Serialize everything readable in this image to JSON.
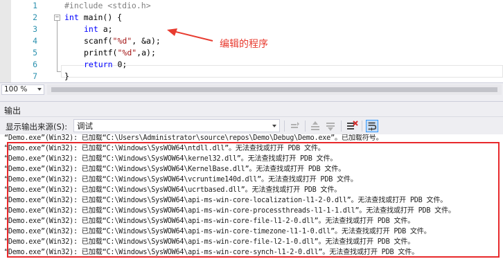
{
  "editor": {
    "line_numbers": [
      "1",
      "2",
      "3",
      "4",
      "5",
      "6",
      "7"
    ],
    "include_text": "#include <stdio.h>",
    "main_kw": "int",
    "main_sig": " main() {",
    "decl_kw": "int",
    "decl_rest": " a;",
    "scanf_pre": "scanf(",
    "scanf_str": "\"%d\"",
    "scanf_post": ", &a);",
    "printf_pre": "printf(",
    "printf_str": "\"%d\"",
    "printf_post": ",a);",
    "return_kw": "return",
    "return_rest": " 0;",
    "close_brace": "}",
    "fold_symbol": "−"
  },
  "annotation": {
    "text": "编辑的程序",
    "color": "#e83b2f"
  },
  "zoombar": {
    "zoom_level": "100 %"
  },
  "output": {
    "title": "输出",
    "source_label": "显示输出来源(S):",
    "source_value": "调试",
    "lines": [
      "“Demo.exe”(Win32): 已加载“C:\\Users\\Administrator\\source\\repos\\Demo\\Debug\\Demo.exe”。已加载符号。",
      "“Demo.exe”(Win32): 已加载“C:\\Windows\\SysWOW64\\ntdll.dll”。无法查找或打开 PDB 文件。",
      "“Demo.exe”(Win32): 已加载“C:\\Windows\\SysWOW64\\kernel32.dll”。无法查找或打开 PDB 文件。",
      "“Demo.exe”(Win32): 已加载“C:\\Windows\\SysWOW64\\KernelBase.dll”。无法查找或打开 PDB 文件。",
      "“Demo.exe”(Win32): 已加载“C:\\Windows\\SysWOW64\\vcruntime140d.dll”。无法查找或打开 PDB 文件。",
      "“Demo.exe”(Win32): 已加载“C:\\Windows\\SysWOW64\\ucrtbased.dll”。无法查找或打开 PDB 文件。",
      "“Demo.exe”(Win32): 已加载“C:\\Windows\\SysWOW64\\api-ms-win-core-localization-l1-2-0.dll”。无法查找或打开 PDB 文件。",
      "“Demo.exe”(Win32): 已加载“C:\\Windows\\SysWOW64\\api-ms-win-core-processthreads-l1-1-1.dll”。无法查找或打开 PDB 文件。",
      "“Demo.exe”(Win32): 已加载“C:\\Windows\\SysWOW64\\api-ms-win-core-file-l1-2-0.dll”。无法查找或打开 PDB 文件。",
      "“Demo.exe”(Win32): 已加载“C:\\Windows\\SysWOW64\\api-ms-win-core-timezone-l1-1-0.dll”。无法查找或打开 PDB 文件。",
      "“Demo.exe”(Win32): 已加载“C:\\Windows\\SysWOW64\\api-ms-win-core-file-l2-1-0.dll”。无法查找或打开 PDB 文件。",
      "“Demo.exe”(Win32): 已加载“C:\\Windows\\SysWOW64\\api-ms-win-core-synch-l1-2-0.dll”。无法查找或打开 PDB 文件。"
    ]
  },
  "colors": {
    "line_number": "#2b91af",
    "keyword": "#0000ff",
    "string": "#a31515",
    "preprocessor": "#808080",
    "highlight_border": "#e8282b"
  }
}
